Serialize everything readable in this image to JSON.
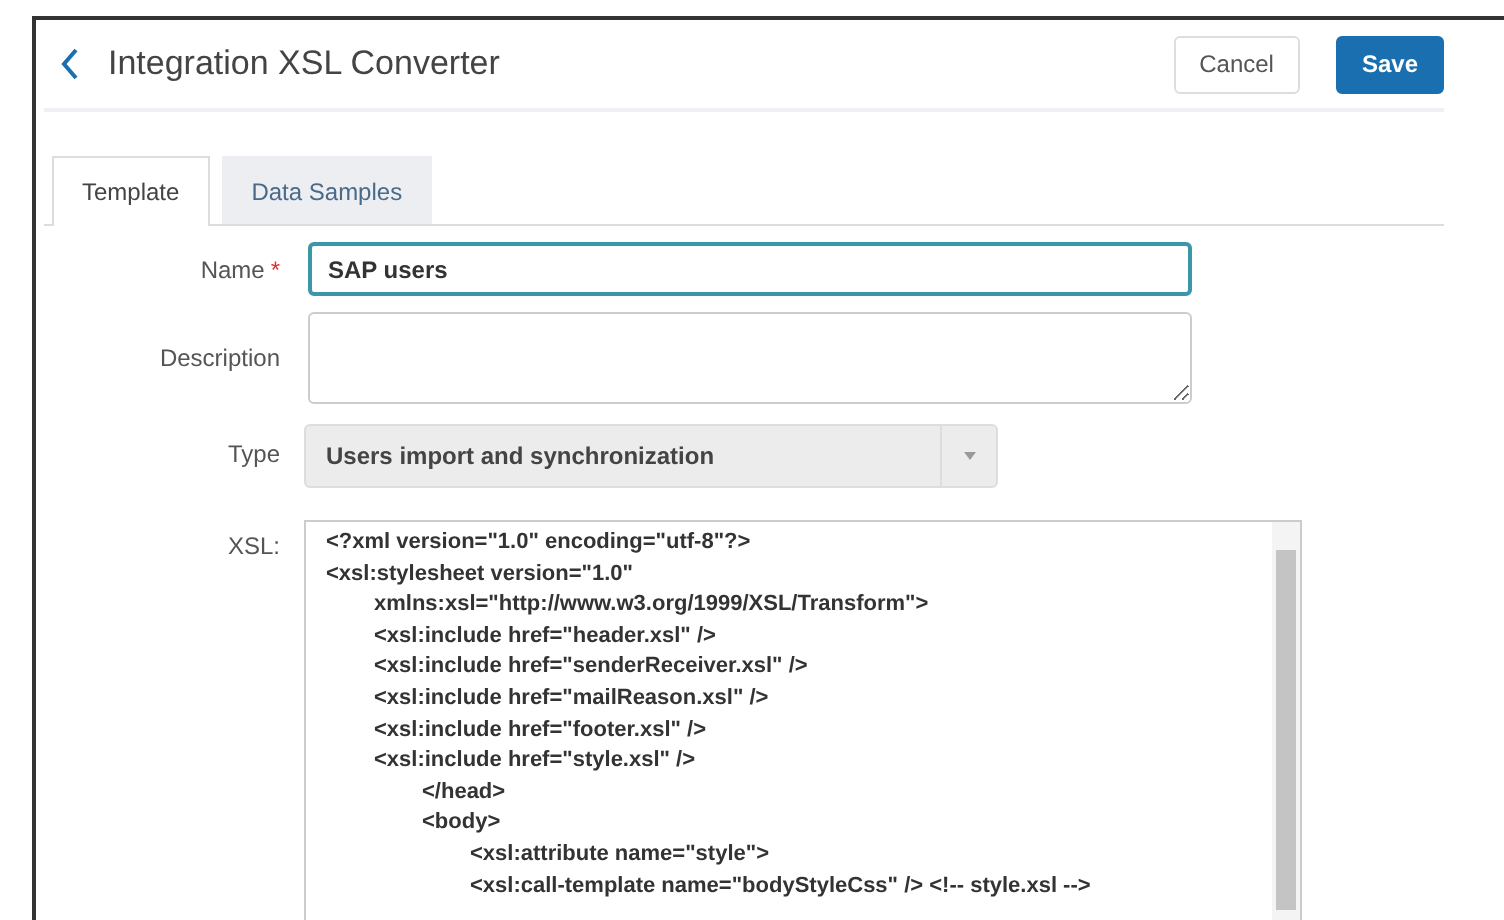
{
  "header": {
    "title": "Integration XSL Converter",
    "buttons": [
      {
        "label": "Cancel",
        "kind": "secondary"
      },
      {
        "label": "Save",
        "kind": "primary"
      }
    ]
  },
  "tabs": [
    {
      "label": "Template",
      "selected": true
    },
    {
      "label": "Data Samples",
      "selected": false
    }
  ],
  "form": {
    "name": {
      "label": "Name",
      "required": true,
      "required_mark": "*",
      "value": "SAP users"
    },
    "description": {
      "label": "Description"
    },
    "type": {
      "label": "Type",
      "value": "Users import and synchronization"
    },
    "xsl": {
      "label": "XSL:",
      "lines": [
        {
          "text": "<?xml version=\"1.0\" encoding=\"utf-8\"?>"
        },
        {
          "text": "<xsl:stylesheet version=\"1.0\"",
          "children": [
            {
              "text": "xmlns:xsl=\"http://www.w3.org/1999/XSL/Transform\">"
            },
            {
              "text": "<xsl:include href=\"header.xsl\" />"
            },
            {
              "text": "<xsl:include href=\"senderReceiver.xsl\" />"
            },
            {
              "text": "<xsl:include href=\"mailReason.xsl\" />"
            },
            {
              "text": "<xsl:include href=\"footer.xsl\" />"
            },
            {
              "text": "<xsl:include href=\"style.xsl\" />",
              "children": [
                {
                  "text": "</head>"
                },
                {
                  "text": "<body>",
                  "children": [
                    {
                      "text": "<xsl:attribute name=\"style\">"
                    },
                    {
                      "text": "<xsl:call-template name=\"bodyStyleCss\" /> <!-- style.xsl -->"
                    }
                  ]
                }
              ]
            }
          ]
        }
      ]
    }
  }
}
